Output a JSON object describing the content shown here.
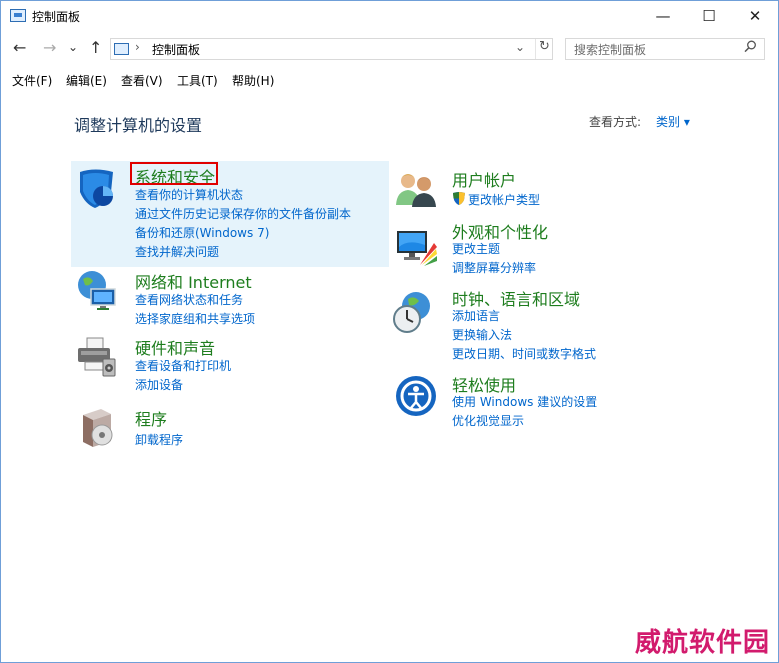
{
  "window": {
    "title": "控制面板",
    "controls": {
      "minimize": "—",
      "maximize": "☐",
      "close": "✕"
    }
  },
  "nav": {
    "back": "←",
    "forward": "→",
    "recent": "⌄",
    "up": "↑",
    "address_sep": "›",
    "address": "控制面板",
    "address_dropdown": "⌄",
    "refresh": "↻",
    "search_placeholder": "搜索控制面板"
  },
  "menubar": [
    "文件(F)",
    "编辑(E)",
    "查看(V)",
    "工具(T)",
    "帮助(H)"
  ],
  "main": {
    "heading": "调整计算机的设置",
    "view_by_label": "查看方式:",
    "view_by_value": "类别 ▾"
  },
  "categories": [
    {
      "title": "系统和安全",
      "icon": "shield-icon",
      "links": [
        "查看你的计算机状态",
        "通过文件历史记录保存你的文件备份副本",
        "备份和还原(Windows 7)",
        "查找并解决问题"
      ]
    },
    {
      "title": "网络和 Internet",
      "icon": "network-globe-icon",
      "links": [
        "查看网络状态和任务",
        "选择家庭组和共享选项"
      ]
    },
    {
      "title": "硬件和声音",
      "icon": "printer-icon",
      "links": [
        "查看设备和打印机",
        "添加设备"
      ]
    },
    {
      "title": "程序",
      "icon": "programs-icon",
      "links": [
        "卸载程序"
      ]
    },
    {
      "title": "用户帐户",
      "icon": "users-icon",
      "links": [
        "更改帐户类型"
      ]
    },
    {
      "title": "外观和个性化",
      "icon": "appearance-icon",
      "links": [
        "更改主题",
        "调整屏幕分辨率"
      ]
    },
    {
      "title": "时钟、语言和区域",
      "icon": "clock-globe-icon",
      "links": [
        "添加语言",
        "更换输入法",
        "更改日期、时间或数字格式"
      ]
    },
    {
      "title": "轻松使用",
      "icon": "ease-of-access-icon",
      "links": [
        "使用 Windows 建议的设置",
        "优化视觉显示"
      ]
    }
  ],
  "watermark": "威航软件园"
}
